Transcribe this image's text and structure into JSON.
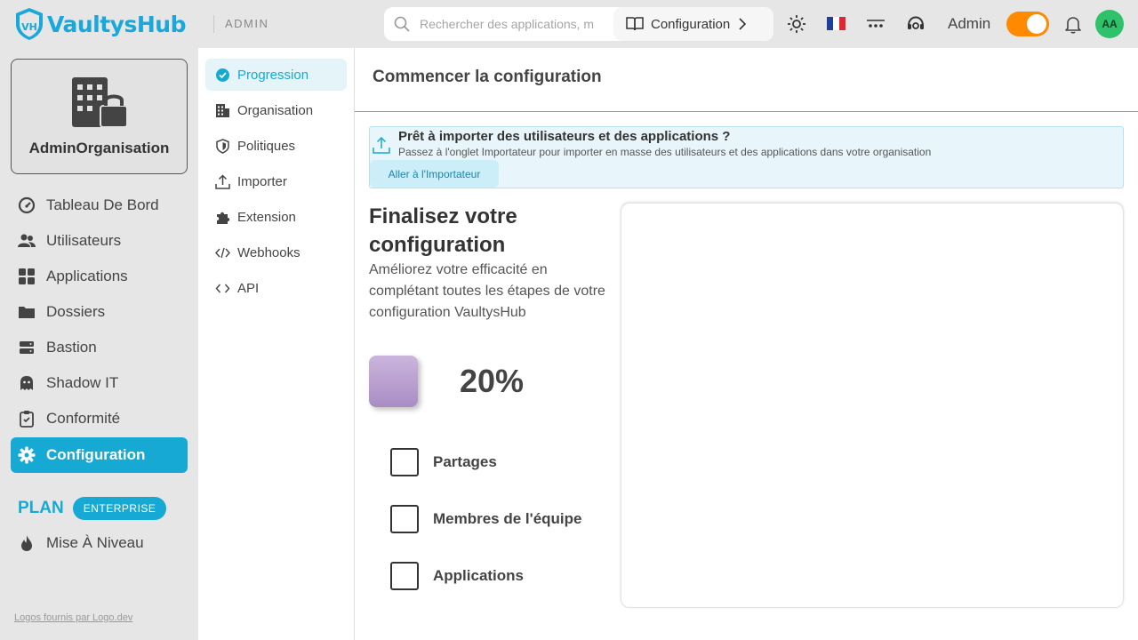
{
  "header": {
    "brand": "VaultysHub",
    "section": "ADMIN",
    "search_placeholder": "Rechercher des applications, m",
    "config_button": "Configuration",
    "user_label": "Admin",
    "avatar_initials": "AA",
    "toggle_color": "#ff8a00"
  },
  "sidebar": {
    "org_name": "AdminOrganisation",
    "items": [
      {
        "label": "Tableau De Bord",
        "icon": "gauge-icon"
      },
      {
        "label": "Utilisateurs",
        "icon": "users-icon"
      },
      {
        "label": "Applications",
        "icon": "grid-icon"
      },
      {
        "label": "Dossiers",
        "icon": "folder-icon"
      },
      {
        "label": "Bastion",
        "icon": "server-icon"
      },
      {
        "label": "Shadow IT",
        "icon": "ghost-icon"
      },
      {
        "label": "Conformité",
        "icon": "clipboard-icon"
      },
      {
        "label": "Configuration",
        "icon": "gear-icon",
        "active": true
      }
    ],
    "plan_label": "PLAN",
    "plan_badge": "ENTERPRISE",
    "upgrade": "Mise À Niveau",
    "logos_credit": "Logos fournis par Logo.dev",
    "accent": "#16a9d3"
  },
  "subnav": {
    "items": [
      {
        "label": "Progression",
        "active": true
      },
      {
        "label": "Organisation"
      },
      {
        "label": "Politiques"
      },
      {
        "label": "Importer"
      },
      {
        "label": "Extension"
      },
      {
        "label": "Webhooks"
      },
      {
        "label": "API"
      }
    ]
  },
  "main": {
    "title": "Commencer la configuration",
    "banner": {
      "title": "Prêt à importer des utilisateurs et des applications ?",
      "text": "Passez à l'onglet Importateur pour importer en masse des utilisateurs et des applications dans votre organisation",
      "button": "Aller à l'Importateur"
    },
    "finalize_title": "Finalisez votre configuration",
    "finalize_desc": "Améliorez votre efficacité en complétant toutes les étapes de votre configuration VaultysHub",
    "progress": "20%",
    "progress_value": 20,
    "tasks": [
      {
        "label": "Partages",
        "checked": false
      },
      {
        "label": "Membres de l'équipe",
        "checked": false
      },
      {
        "label": "Applications",
        "checked": false
      }
    ]
  }
}
